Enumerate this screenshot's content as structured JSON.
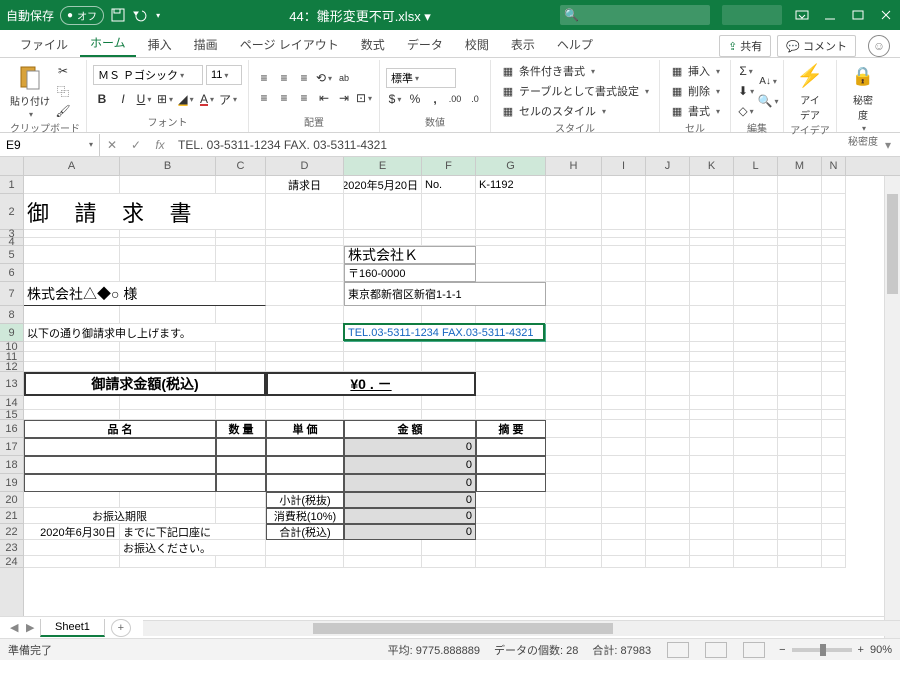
{
  "titlebar": {
    "autosave_label": "自動保存",
    "autosave_state": "オフ",
    "filename": "44：雛形変更不可.xlsx ▾"
  },
  "tabs": [
    "ファイル",
    "ホーム",
    "挿入",
    "描画",
    "ページ レイアウト",
    "数式",
    "データ",
    "校閲",
    "表示",
    "ヘルプ"
  ],
  "share_label": "共有",
  "comment_label": "コメント",
  "ribbon": {
    "clipboard": {
      "paste": "貼り付け",
      "group": "クリップボード"
    },
    "font": {
      "name": "ＭＳ Ｐゴシック",
      "size": "11",
      "group": "フォント"
    },
    "align": {
      "wrap": "ab",
      "group": "配置"
    },
    "number": {
      "style": "標準",
      "group": "数値"
    },
    "styles": {
      "cond": "条件付き書式",
      "table": "テーブルとして書式設定",
      "cellstyle": "セルのスタイル",
      "group": "スタイル"
    },
    "cells": {
      "insert": "挿入",
      "delete": "削除",
      "format": "書式",
      "group": "セル"
    },
    "editing": {
      "group": "編集"
    },
    "idea": {
      "label": "アイ\nデア",
      "group": "アイデア"
    },
    "sensitivity": {
      "label": "秘密\n度",
      "group": "秘密度"
    }
  },
  "namebox": "E9",
  "formula": "TEL. 03-5311-1234 FAX. 03-5311-4321",
  "columns": [
    "A",
    "B",
    "C",
    "D",
    "E",
    "F",
    "G",
    "H",
    "I",
    "J",
    "K",
    "L",
    "M",
    "N"
  ],
  "selected_cols": [
    "E",
    "F",
    "G"
  ],
  "row_numbers": [
    1,
    2,
    3,
    4,
    5,
    6,
    7,
    8,
    9,
    10,
    11,
    12,
    13,
    14,
    15,
    16,
    17,
    18,
    19,
    20,
    21,
    22,
    23,
    24
  ],
  "selected_row": 9,
  "doc": {
    "invoice_date_label": "請求日",
    "invoice_date": "2020年5月20日",
    "invoice_no_label": "No.",
    "invoice_no": "K-1192",
    "title": "御 請 求 書",
    "client": "株式会社△◆○  様",
    "company_name": "株式会社Ｋ",
    "company_zip": "〒160-0000",
    "company_addr": "東京都新宿区新宿1-1-1",
    "company_tel": "TEL.03-5311-1234 FAX.03-5311-4321",
    "intro": "以下の通り御請求申し上げます。",
    "amount_label": "御請求金額(税込)",
    "amount_value": "¥0 . －",
    "cols_item": "品 名",
    "cols_qty": "数 量",
    "cols_price": "単 価",
    "cols_amount": "金 額",
    "cols_note": "摘 要",
    "zero": "0",
    "subtotal": "小計(税抜)",
    "tax": "消費税(10%)",
    "total": "合計(税込)",
    "due_label": "お振込期限",
    "due_date": "2020年6月30日",
    "due_note1": "までに下記口座に",
    "due_note2": "お振込ください。"
  },
  "sheet": {
    "name": "Sheet1"
  },
  "status": {
    "ready": "準備完了",
    "avg": "平均: 9775.888889",
    "count": "データの個数: 28",
    "sum": "合計: 87983",
    "zoom": "90%"
  },
  "colwidths": {
    "A": 96,
    "B": 96,
    "C": 50,
    "D": 78,
    "E": 78,
    "F": 54,
    "G": 70,
    "H": 56,
    "I": 44,
    "J": 44,
    "K": 44,
    "L": 44,
    "M": 44,
    "N": 24
  },
  "rowheights": {
    "1": 18,
    "2": 36,
    "3": 8,
    "4": 8,
    "5": 18,
    "6": 18,
    "7": 24,
    "8": 18,
    "9": 18,
    "10": 10,
    "11": 10,
    "12": 10,
    "13": 24,
    "14": 14,
    "15": 10,
    "16": 18,
    "17": 18,
    "18": 18,
    "19": 18,
    "20": 16,
    "21": 16,
    "22": 16,
    "23": 16,
    "24": 12
  }
}
